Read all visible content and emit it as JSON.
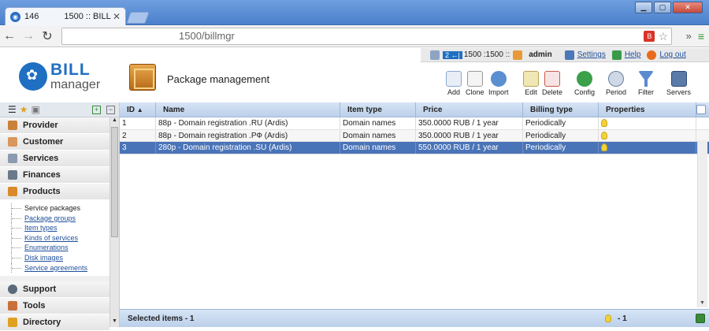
{
  "browser": {
    "tab_id": "146",
    "tab_title": "1500 :: BILL",
    "url": "1500/billmgr",
    "ext_label": "B"
  },
  "userbar": {
    "host": "2 ←|",
    "server": "1500 :1500 ::",
    "user": "admin",
    "settings": "Settings",
    "help": "Help",
    "logout": "Log out"
  },
  "app": {
    "logo_top": "BILL",
    "logo_bottom": "manager",
    "page_title": "Package management"
  },
  "toolbar": {
    "add": "Add",
    "clone": "Clone",
    "import": "Import",
    "edit": "Edit",
    "delete": "Delete",
    "config": "Config",
    "period": "Period",
    "filter": "Filter",
    "servers": "Servers"
  },
  "sidebar": {
    "groups": [
      "Provider",
      "Customer",
      "Services",
      "Finances",
      "Products"
    ],
    "products_items": [
      "Service packages",
      "Package groups",
      "Item types",
      "Kinds of services",
      "Enumerations",
      "Disk images",
      "Service agreements"
    ],
    "groups_bottom": [
      "Support",
      "Tools",
      "Directory"
    ]
  },
  "table": {
    "columns": [
      "ID",
      "Name",
      "Item type",
      "Price",
      "Billing type",
      "Properties"
    ],
    "rows": [
      {
        "id": "1",
        "name": "88p - Domain registration .RU (Ardis)",
        "item_type": "Domain names",
        "price": "350.0000 RUB / 1 year",
        "billing": "Periodically"
      },
      {
        "id": "2",
        "name": "88p - Domain registration .РФ (Ardis)",
        "item_type": "Domain names",
        "price": "350.0000 RUB / 1 year",
        "billing": "Periodically"
      },
      {
        "id": "3",
        "name": "280p - Domain registration .SU (Ardis)",
        "item_type": "Domain names",
        "price": "550.0000 RUB / 1 year",
        "billing": "Periodically"
      }
    ],
    "footer_selected": "Selected items - 1",
    "footer_count": "- 1"
  }
}
